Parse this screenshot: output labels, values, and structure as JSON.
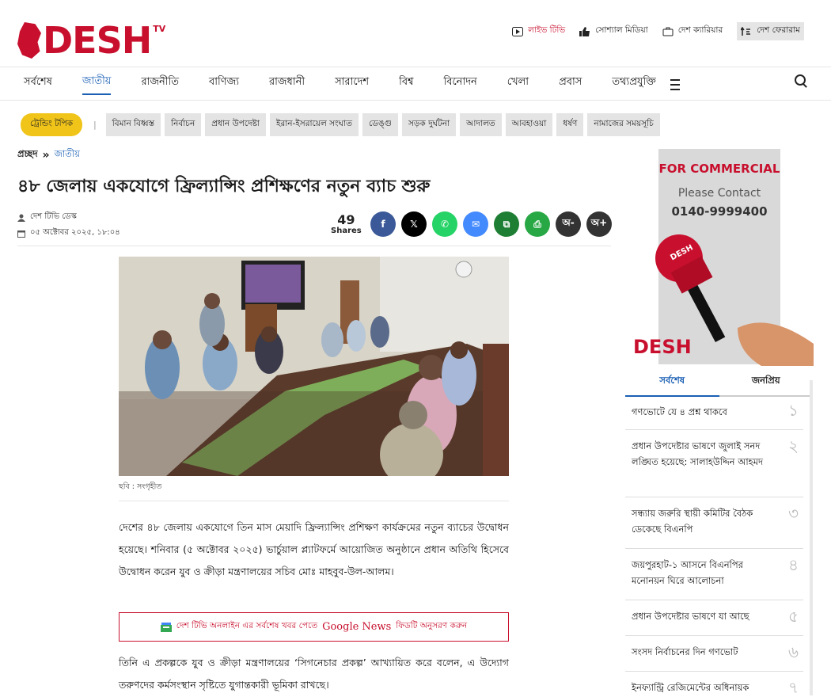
{
  "header": {
    "logo_text": "DESH",
    "logo_tv": "TV",
    "links": [
      {
        "label": "লাইভ টিভি",
        "icon": "play-icon"
      },
      {
        "label": "সোশ্যাল মিডিয়া",
        "icon": "thumbs-up-icon"
      },
      {
        "label": "দেশ ক্যারিয়ার",
        "icon": "briefcase-icon"
      },
      {
        "label": "দেশ ফেরারাম",
        "icon": "rss-icon"
      }
    ]
  },
  "nav": {
    "items": [
      "সর্বশেষ",
      "জাতীয়",
      "রাজনীতি",
      "বাণিজ্য",
      "রাজধানী",
      "সারাদেশ",
      "বিশ্ব",
      "বিনোদন",
      "খেলা",
      "প্রবাস",
      "তথ্যপ্রযুক্তি"
    ],
    "active": "জাতীয়"
  },
  "trending": {
    "label": "ট্রেন্ডিং টপিক",
    "tags": [
      "বিমান বিধ্বস্ত",
      "নির্বাচন",
      "প্রধান উপদেষ্টা",
      "ইরান-ইসরায়েল সংঘাত",
      "ডেঙ্গু",
      "সড়ক দুর্ঘটনা",
      "আদালত",
      "আবহাওয়া",
      "ধর্ষণ",
      "নামাজের সময়সূচি"
    ]
  },
  "breadcrumb": {
    "home": "প্রচ্ছদ",
    "separator": "»",
    "current": "জাতীয়"
  },
  "article": {
    "headline": "৪৮ জেলায় একযোগে ফ্রিল্যান্সিং প্রশিক্ষণের নতুন ব্যাচ শুরু",
    "author": "দেশ টিভি ডেস্ক",
    "date": "০৫ অক্টোবর ২০২৫, ১৮:০৪",
    "shares_count": "49",
    "shares_label": "Shares",
    "caption": "ছবি : সংগৃহীত",
    "para1": "দেশের ৪৮ জেলায় একযোগে তিন মাস মেয়াদি ফ্রিল্যান্সিং প্রশিক্ষণ কার্যক্রমের নতুন ব্যাচের উদ্বোধন হয়েছে। শনিবার (৫ অক্টোবর ২০২৫) ভার্চুয়াল প্ল্যাটফর্মে আয়োজিত অনুষ্ঠানে প্রধান অতিথি হিসেবে উদ্বোধন করেন যুব ও ক্রীড়া মন্ত্রণালয়ের সচিব মোঃ মাহবুব-উল-আলম।",
    "gnews_pre": "দেশ টিভি অনলাইন এর সর্বশেষ খবর পেতে",
    "gnews_brand": "Google News",
    "gnews_post": "ফিডটি অনুসরণ করুন",
    "para2": "তিনি এ প্রকল্পকে যুব ও ক্রীড়া মন্ত্রণালয়ের ‘সিগনেচার প্রকল্প’ আখ্যায়িত করে বলেন, এ উদ্যোগ তরুণদের কর্মসংস্থান সৃষ্টিতে যুগান্তকারী ভূমিকা রাখছে।"
  },
  "share_buttons": [
    {
      "name": "facebook",
      "glyph": "f",
      "color": "#3b5998"
    },
    {
      "name": "x",
      "glyph": "𝕏",
      "color": "#000000"
    },
    {
      "name": "whatsapp",
      "glyph": "✆",
      "color": "#25d366"
    },
    {
      "name": "messenger",
      "glyph": "✉",
      "color": "#448aff"
    },
    {
      "name": "copy",
      "glyph": "⧉",
      "color": "#1e7e34"
    },
    {
      "name": "print",
      "glyph": "⎙",
      "color": "#28a745"
    },
    {
      "name": "font-decrease",
      "glyph": "অ-",
      "color": "#333333"
    },
    {
      "name": "font-increase",
      "glyph": "অ+",
      "color": "#333333"
    }
  ],
  "ad": {
    "line1": "FOR COMMERCIAL",
    "line2": "Please Contact",
    "phone": "0140-9999400",
    "logo": "DESH",
    "mic_text": "DESH"
  },
  "sidebar": {
    "tabs": [
      "সর্বশেষ",
      "জনপ্রিয়"
    ],
    "items": [
      {
        "text": "গণভোটে যে ৪ প্রশ্ন থাকবে",
        "num": "১"
      },
      {
        "text": "প্রধান উপদেষ্টার ভাষণে জুলাই সনদ লঙ্ঘিত হয়েছে: সালাহউদ্দিন আহমদ",
        "num": "২"
      },
      {
        "text": "সন্ধ্যায় জরুরি স্থায়ী কমিটির বৈঠক ডেকেছে বিএনপি",
        "num": "৩"
      },
      {
        "text": "জয়পুরহাট-১ আসনে বিএনপির মনোনয়ন ঘিরে আলোচনা",
        "num": "৪"
      },
      {
        "text": "প্রধান উপদেষ্টার ভাষণে যা আছে",
        "num": "৫"
      },
      {
        "text": "সংসদ নির্বাচনের দিন গণভোট",
        "num": "৬"
      },
      {
        "text": "ইনফ্যান্ট্রি রেজিমেন্টের অধিনায়ক",
        "num": "৭"
      }
    ]
  }
}
